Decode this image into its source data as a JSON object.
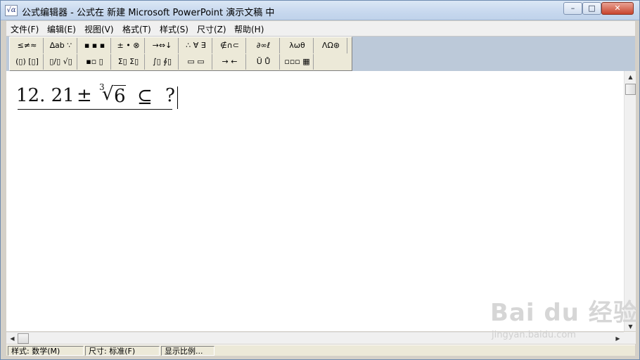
{
  "window": {
    "title": "公式编辑器 - 公式在 新建 Microsoft PowerPoint 演示文稿 中",
    "icon": "sqrt-alpha-app-icon",
    "controls": {
      "minimize": "–",
      "maximize": "□",
      "close": "✕"
    }
  },
  "menu": [
    {
      "label": "文件(F)"
    },
    {
      "label": "编辑(E)"
    },
    {
      "label": "视图(V)"
    },
    {
      "label": "格式(T)"
    },
    {
      "label": "样式(S)"
    },
    {
      "label": "尺寸(Z)"
    },
    {
      "label": "帮助(H)"
    }
  ],
  "toolbar": {
    "row1": [
      {
        "label": "≤≠≈",
        "icon": "relations-palette-icon"
      },
      {
        "label": "∆ab ∵",
        "icon": "spaces-ellipses-palette-icon"
      },
      {
        "label": "▪ ▪ ▪",
        "icon": "embellishments-palette-icon"
      },
      {
        "label": "± • ⊗",
        "icon": "operators-palette-icon"
      },
      {
        "label": "→⇔↓",
        "icon": "arrows-palette-icon"
      },
      {
        "label": "∴ ∀ ∃",
        "icon": "logic-palette-icon"
      },
      {
        "label": "∉∩⊂",
        "icon": "set-theory-palette-icon"
      },
      {
        "label": "∂∞ℓ",
        "icon": "misc-symbols-palette-icon"
      },
      {
        "label": "λωθ",
        "icon": "greek-lowercase-palette-icon"
      },
      {
        "label": "ΛΩ⊛",
        "icon": "greek-uppercase-palette-icon"
      }
    ],
    "row2": [
      {
        "label": "(▯) [▯]",
        "icon": "fences-template-icon"
      },
      {
        "label": "▯/▯ √▯",
        "icon": "fraction-radical-template-icon"
      },
      {
        "label": "▪▫ ▯",
        "icon": "script-template-icon"
      },
      {
        "label": "Σ▯ Σ▯",
        "icon": "summation-template-icon"
      },
      {
        "label": "∫▯ ∮▯",
        "icon": "integral-template-icon"
      },
      {
        "label": "▭ ▭",
        "icon": "bar-template-icon"
      },
      {
        "label": "→ ←",
        "icon": "labeled-arrow-template-icon"
      },
      {
        "label": "Ũ Ů",
        "icon": "products-template-icon"
      },
      {
        "label": "▫▫▫ ▦",
        "icon": "matrix-template-icon"
      }
    ]
  },
  "equation": {
    "number": "12. 21",
    "plus_minus": "±",
    "root_index": "3",
    "radical": "√",
    "radicand": "6",
    "subset": "⊆",
    "question": "?"
  },
  "statusbar": {
    "style": "样式: 数学(M)",
    "size": "尺寸: 标准(F)",
    "zoom": "显示比例..."
  },
  "watermark": {
    "logo": "Bai du 经验",
    "url": "jingyan.baidu.com"
  },
  "scroll": {
    "up": "▲",
    "down": "▼",
    "left": "◀",
    "right": "▶"
  }
}
